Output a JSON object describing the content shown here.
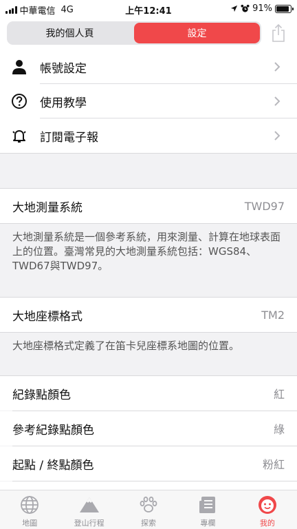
{
  "status_bar": {
    "carrier": "中華電信",
    "network": "4G",
    "time": "上午12:41",
    "battery": "91%",
    "battery_level": 0.91
  },
  "header": {
    "segments": [
      {
        "label": "我的個人頁",
        "active": false
      },
      {
        "label": "設定",
        "active": true
      }
    ],
    "share_icon": "share-icon"
  },
  "menu": [
    {
      "label": "帳號設定",
      "icon": "person-icon"
    },
    {
      "label": "使用教學",
      "icon": "question-circle-icon"
    },
    {
      "label": "訂閱電子報",
      "icon": "bell-icon"
    }
  ],
  "datum": {
    "label": "大地測量系統",
    "value": "TWD97",
    "description": "大地測量系統是一個參考系統，用來測量、計算在地球表面上的位置。臺灣常見的大地測量系統包括：WGS84、TWD67與TWD97。"
  },
  "coord_format": {
    "label": "大地座標格式",
    "value": "TM2",
    "description": "大地座標格式定義了在笛卡兒座標系地圖的位置。"
  },
  "colors": [
    {
      "label": "紀錄點顏色",
      "value": "紅"
    },
    {
      "label": "參考紀錄點顏色",
      "value": "綠"
    },
    {
      "label": "起點 / 終點顏色",
      "value": "粉紅"
    }
  ],
  "tabs": [
    {
      "label": "地圖",
      "icon": "globe-icon",
      "active": false
    },
    {
      "label": "登山行程",
      "icon": "mountain-icon",
      "active": false
    },
    {
      "label": "探索",
      "icon": "paw-icon",
      "active": false
    },
    {
      "label": "專欄",
      "icon": "article-icon",
      "active": false
    },
    {
      "label": "我的",
      "icon": "face-icon",
      "active": true
    }
  ],
  "accent_color": "#f0484a"
}
